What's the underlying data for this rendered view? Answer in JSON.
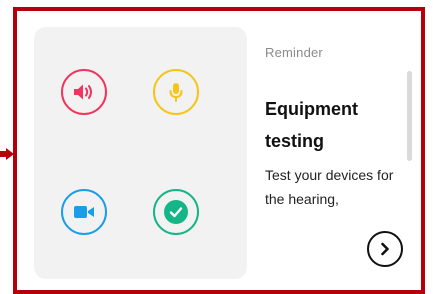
{
  "card": {
    "eyebrow": "Reminder",
    "title": "Equipment testing",
    "description": "Test your devices for the hearing,"
  },
  "icons": [
    {
      "name": "speaker-icon",
      "color": "#f0365f"
    },
    {
      "name": "microphone-icon",
      "color": "#f5c518"
    },
    {
      "name": "camera-icon",
      "color": "#1a9ee8"
    },
    {
      "name": "checkmark-icon",
      "color": "#14b587"
    }
  ],
  "next_button": {
    "icon": "chevron-right-icon"
  },
  "colors": {
    "frame": "#b3000a",
    "panel": "#f2f2f2"
  }
}
